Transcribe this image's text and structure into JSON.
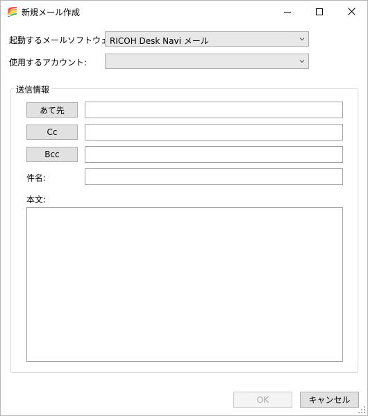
{
  "window": {
    "title": "新規メール作成",
    "icon": "rainbow-pen-app-icon"
  },
  "colors": {
    "button_face": "#e1e1e1",
    "combo_face": "#e8e8e8",
    "disabled_text": "#a8a8a8",
    "border": "#adadad"
  },
  "settings": {
    "mail_software_label": "起動するメールソフトウェア:",
    "mail_software_value": "RICOH Desk Navi メール",
    "account_label": "使用するアカウント:",
    "account_value": ""
  },
  "send_info": {
    "group_title": "送信情報",
    "to_button": "あて先",
    "to_value": "",
    "cc_button": "Cc",
    "cc_value": "",
    "bcc_button": "Bcc",
    "bcc_value": "",
    "subject_label": "件名:",
    "subject_value": "",
    "body_label": "本文:",
    "body_value": ""
  },
  "actions": {
    "ok_label": "OK",
    "cancel_label": "キャンセル"
  }
}
